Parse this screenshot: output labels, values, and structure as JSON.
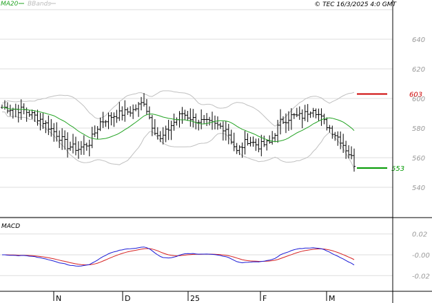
{
  "header": {
    "legend_ma": "MA20",
    "legend_bb": "BBands",
    "copyright": "© TEC 16/3/2025 4:0 GMT"
  },
  "macd_label": "MACD",
  "colors": {
    "grid": "#dddddd",
    "price_bar": "#000000",
    "ma": "#22a322",
    "bbands": "#c0c0c0",
    "macd_line": "#1a1ad6",
    "signal_line": "#d62020",
    "resistance": "#cc0000",
    "support": "#009900",
    "resistance_label": "#cc0000",
    "support_label": "#009900"
  },
  "chart_data": [
    {
      "type": "ohlc",
      "x_labels": [
        "N",
        "D",
        "25",
        "F",
        "M"
      ],
      "y_ticks": [
        540,
        560,
        580,
        600,
        620,
        640
      ],
      "ylim": [
        520,
        660
      ],
      "levels": {
        "resistance": 603,
        "support": 553
      },
      "level_labels": {
        "resistance": "603",
        "support": "553"
      },
      "series": [
        {
          "name": "MA20",
          "type": "line"
        },
        {
          "name": "BBands",
          "type": "band"
        }
      ]
    },
    {
      "type": "line",
      "title": "MACD",
      "y_ticks": [
        0.02,
        -0.0,
        -0.02
      ],
      "y_tick_labels": [
        "0.02",
        "-0.00",
        "-0.02"
      ],
      "ylim": [
        -0.035,
        0.035
      ]
    }
  ]
}
